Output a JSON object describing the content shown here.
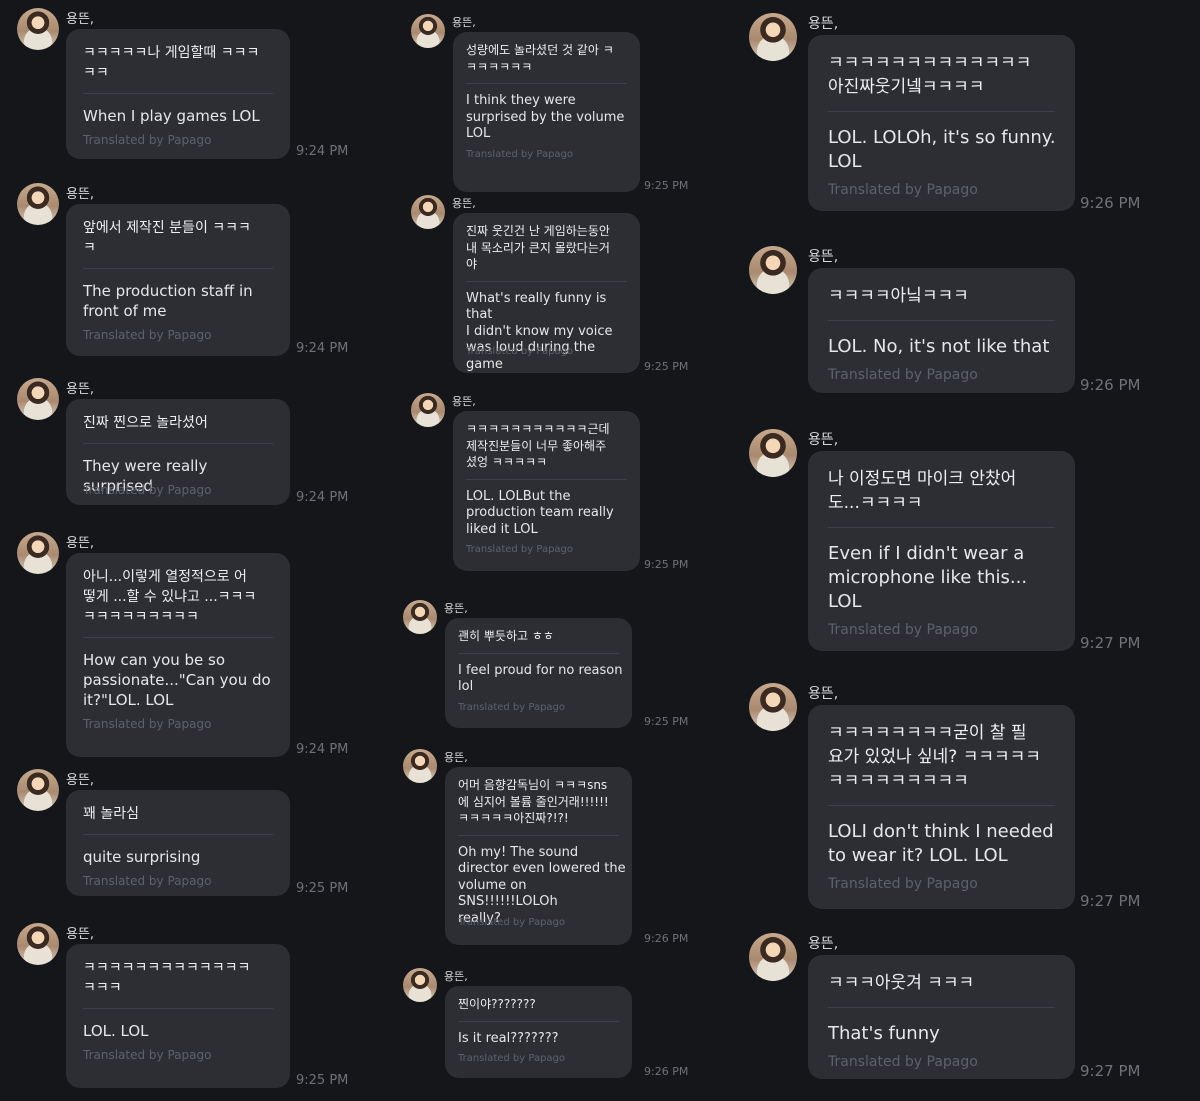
{
  "sender_name": "용뜬,",
  "credit_label": "Translated by Papago",
  "col1": [
    {
      "orig": "ㅋㅋㅋㅋㅋ나 게임할때 ㅋㅋㅋ\nㅋㅋ",
      "trans": "When I play games LOL",
      "time": "9:24 PM"
    },
    {
      "orig": "앞에서 제작진 분들이 ㅋㅋㅋ\nㅋ",
      "trans": "The production staff in\nfront of me",
      "time": "9:24 PM"
    },
    {
      "orig": "진짜 찐으로 놀라셨어",
      "trans": "They were really surprised",
      "time": "9:24 PM"
    },
    {
      "orig": "아니...이렇게 열정적으로 어\n떻게 ...할 수 있냐고 ...ㅋㅋㅋ\nㅋㅋㅋㅋㅋㅋㅋㅋㅋ",
      "trans": "How can you be so\npassionate...\"Can you do\nit?\"LOL. LOL",
      "time": "9:24 PM"
    },
    {
      "orig": "꽤 놀라심",
      "trans": "quite surprising",
      "time": "9:25 PM"
    },
    {
      "orig": "ㅋㅋㅋㅋㅋㅋㅋㅋㅋㅋㅋㅋㅋ\nㅋㅋㅋ",
      "trans": "LOL. LOL",
      "time": "9:25 PM"
    }
  ],
  "col2": [
    {
      "orig": "성량에도 놀라셨던 것 같아 ㅋ\nㅋㅋㅋㅋㅋㅋ",
      "trans": "I think they were\nsurprised by the volume\nLOL",
      "time": "9:25 PM"
    },
    {
      "orig": "진짜 웃긴건 난 게임하는동안\n내 목소리가 큰지 몰랐다는거\n야",
      "trans": "What's really funny is that\nI didn't know my voice\nwas loud during the game",
      "time": "9:25 PM"
    },
    {
      "orig": "ㅋㅋㅋㅋㅋㅋㅋㅋㅋㅋㅋ근데\n제작진분들이 너무 좋아해주\n셨엉 ㅋㅋㅋㅋㅋ",
      "trans": "LOL. LOLBut the\nproduction team really\nliked it LOL",
      "time": "9:25 PM"
    },
    {
      "orig": "괜히 뿌듯하고 ㅎㅎ",
      "trans": "I feel proud for no reason\nlol",
      "time": "9:25 PM"
    },
    {
      "orig": "어머 음향감독님이 ㅋㅋㅋsns\n에 심지어 볼륨 줄인거래!!!!!!\nㅋㅋㅋㅋㅋ아진짜?!?!",
      "trans": "Oh my! The sound\ndirector even lowered the\nvolume on SNS!!!!!!LOLOh\nreally?",
      "time": "9:26 PM"
    },
    {
      "orig": "찐이야???????",
      "trans": "Is it real???????",
      "time": "9:26 PM"
    }
  ],
  "col3": [
    {
      "orig": "ㅋㅋㅋㅋㅋㅋㅋㅋㅋㅋㅋㅋㅋ\n아진짜웃기넼ㅋㅋㅋㅋ",
      "trans": "LOL. LOLOh, it's so funny.\nLOL",
      "time": "9:26 PM"
    },
    {
      "orig": "ㅋㅋㅋㅋ아닠ㅋㅋㅋ",
      "trans": "LOL. No, it's not like that",
      "time": "9:26 PM"
    },
    {
      "orig": "나 이정도면 마이크 안찼어\n도...ㅋㅋㅋㅋ",
      "trans": "Even if I didn't wear a\nmicrophone like this...\nLOL",
      "time": "9:27 PM"
    },
    {
      "orig": "ㅋㅋㅋㅋㅋㅋㅋㅋ굳이 찰 필\n요가 있었나 싶네? ㅋㅋㅋㅋㅋ\nㅋㅋㅋㅋㅋㅋㅋㅋㅋ",
      "trans": "LOLI don't think I needed\nto wear it? LOL. LOL",
      "time": "9:27 PM"
    },
    {
      "orig": "ㅋㅋㅋ아웃겨 ㅋㅋㅋ",
      "trans": "That's funny",
      "time": "9:27 PM"
    }
  ]
}
